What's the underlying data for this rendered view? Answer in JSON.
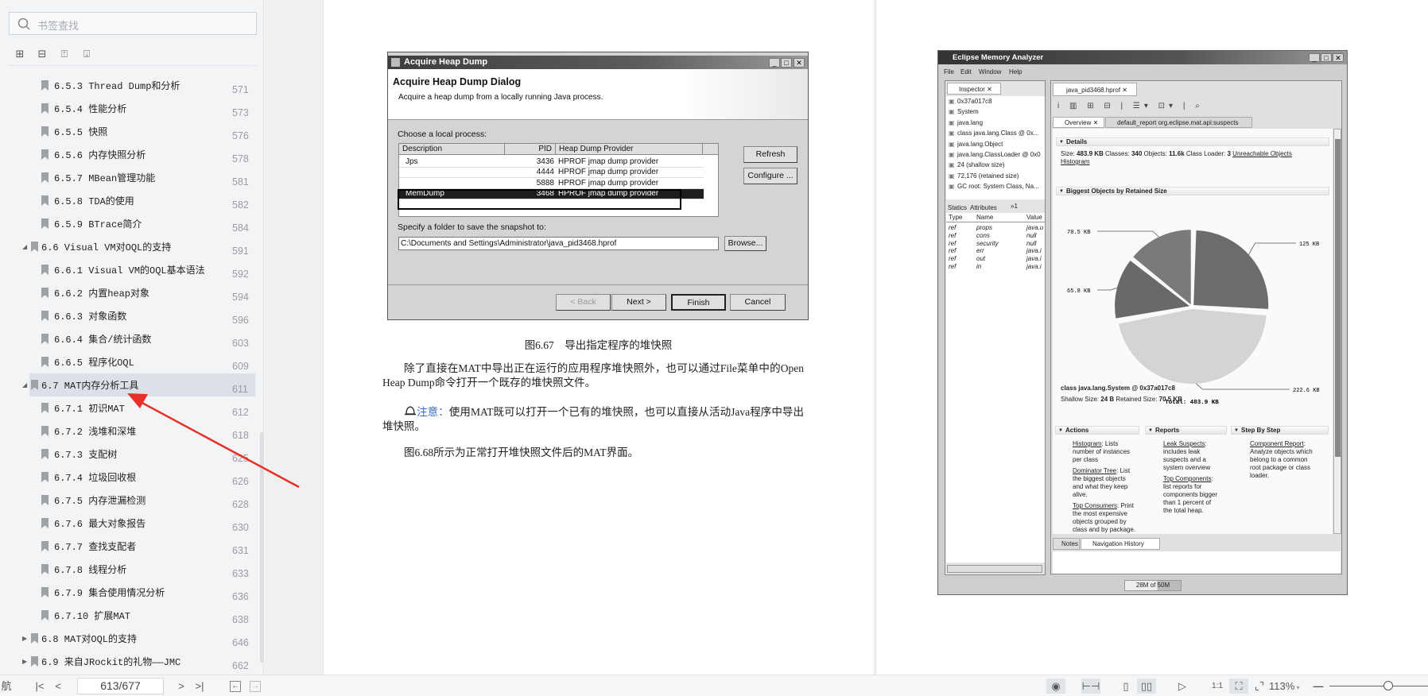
{
  "sidebar": {
    "search_placeholder": "书签查找",
    "tools": [
      "expand-all-icon",
      "collapse-all-icon",
      "add-bookmark-icon",
      "remove-bookmark-icon"
    ],
    "items": [
      {
        "label": "6.5.3 Thread Dump和分析",
        "page": "571",
        "level": 2
      },
      {
        "label": "6.5.4 性能分析",
        "page": "573",
        "level": 2
      },
      {
        "label": "6.5.5 快照",
        "page": "576",
        "level": 2
      },
      {
        "label": "6.5.6 内存快照分析",
        "page": "578",
        "level": 2
      },
      {
        "label": "6.5.7 MBean管理功能",
        "page": "581",
        "level": 2
      },
      {
        "label": "6.5.8 TDA的使用",
        "page": "582",
        "level": 2
      },
      {
        "label": "6.5.9 BTrace简介",
        "page": "584",
        "level": 2
      },
      {
        "label": "6.6 Visual VM对OQL的支持",
        "page": "591",
        "level": 1,
        "state": "expanded"
      },
      {
        "label": "6.6.1 Visual VM的OQL基本语法",
        "page": "592",
        "level": 2
      },
      {
        "label": "6.6.2 内置heap对象",
        "page": "594",
        "level": 2
      },
      {
        "label": "6.6.3 对象函数",
        "page": "596",
        "level": 2
      },
      {
        "label": "6.6.4 集合/统计函数",
        "page": "603",
        "level": 2
      },
      {
        "label": "6.6.5 程序化OQL",
        "page": "609",
        "level": 2
      },
      {
        "label": "6.7 MAT内存分析工具",
        "page": "611",
        "level": 1,
        "state": "expanded",
        "selected": true
      },
      {
        "label": "6.7.1 初识MAT",
        "page": "612",
        "level": 2
      },
      {
        "label": "6.7.2 浅堆和深堆",
        "page": "618",
        "level": 2
      },
      {
        "label": "6.7.3 支配树",
        "page": "625",
        "level": 2
      },
      {
        "label": "6.7.4 垃圾回收根",
        "page": "626",
        "level": 2
      },
      {
        "label": "6.7.5 内存泄漏检测",
        "page": "628",
        "level": 2
      },
      {
        "label": "6.7.6 最大对象报告",
        "page": "630",
        "level": 2
      },
      {
        "label": "6.7.7 查找支配者",
        "page": "631",
        "level": 2
      },
      {
        "label": "6.7.8 线程分析",
        "page": "633",
        "level": 2
      },
      {
        "label": "6.7.9 集合使用情况分析",
        "page": "636",
        "level": 2
      },
      {
        "label": "6.7.10 扩展MAT",
        "page": "638",
        "level": 2
      },
      {
        "label": "6.8 MAT对OQL的支持",
        "page": "646",
        "level": 1,
        "state": "collapsed"
      },
      {
        "label": "6.9 来自JRockit的礼物——JMC",
        "page": "662",
        "level": 1,
        "state": "collapsed"
      }
    ]
  },
  "annotation": {
    "arrow_color": "#e8302a"
  },
  "dialog": {
    "window_title": "Acquire Heap Dump",
    "heading": "Acquire Heap Dump Dialog",
    "subheading": "Acquire a heap dump from a locally running Java process.",
    "choose_label": "Choose a local process:",
    "columns": [
      "Description",
      "PID",
      "Heap Dump Provider"
    ],
    "rows": [
      {
        "desc": "Jps",
        "pid": "3436",
        "provider": "HPROF jmap dump provider"
      },
      {
        "desc": "",
        "pid": "4444",
        "provider": "HPROF jmap dump provider"
      },
      {
        "desc": "",
        "pid": "5888",
        "provider": "HPROF jmap dump provider"
      },
      {
        "desc": "MemDump",
        "pid": "3468",
        "provider": "HPROF jmap dump provider",
        "selected": true
      }
    ],
    "refresh": "Refresh",
    "configure": "Configure ...",
    "folder_label": "Specify a folder to save the snapshot to:",
    "folder_value": "C:\\Documents and Settings\\Administrator\\java_pid3468.hprof",
    "browse": "Browse...",
    "back": "< Back",
    "next": "Next >",
    "finish": "Finish",
    "cancel": "Cancel"
  },
  "document": {
    "caption": "图6.67　导出指定程序的堆快照",
    "para1": "除了直接在MAT中导出正在运行的应用程序堆快照外，也可以通过File菜单中的Open Heap Dump命令打开一个既存的堆快照文件。",
    "note_label": "注意：",
    "note_text": "使用MAT既可以打开一个已有的堆快照，也可以直接从活动Java程序中导出堆快照。",
    "para2": "图6.68所示为正常打开堆快照文件后的MAT界面。",
    "note_color": "#3a6fc4"
  },
  "mat": {
    "window_title": "Eclipse Memory Analyzer",
    "menu": [
      "File",
      "Edit",
      "Window",
      "Help"
    ],
    "inspector_tab": "Inspector",
    "inspector_items": [
      "0x37a017c8",
      "System",
      "java.lang",
      "class java.lang.Class @ 0x...",
      "java.lang.Object",
      "java.lang.ClassLoader @ 0x0",
      "24 (shallow size)",
      "72,176 (retained size)",
      "GC root: System Class, Na..."
    ],
    "statics_tabs": [
      "Statics",
      "Attributes",
      "»1"
    ],
    "statics_columns": [
      "Type",
      "Name",
      "Value"
    ],
    "statics_rows": [
      [
        "ref",
        "props",
        "java.u"
      ],
      [
        "ref",
        "cons",
        "null"
      ],
      [
        "ref",
        "security",
        "null"
      ],
      [
        "ref",
        "err",
        "java.i"
      ],
      [
        "ref",
        "out",
        "java.i"
      ],
      [
        "ref",
        "in",
        "java.i"
      ]
    ],
    "editor_tab": "java_pid3468.hprof",
    "overview_tab": "Overview",
    "report_tab": "default_report  org.eclipse.mat.api:suspects",
    "details_header": "Details",
    "details": {
      "size_label": "Size: ",
      "size": "483.9 KB",
      "classes_label": " Classes: ",
      "classes": "340",
      "objects_label": " Objects: ",
      "objects": "11.6k",
      "loader_label": " Class Loader: ",
      "loader": "3",
      "unreachable": "Unreachable Objects",
      "histogram": "Histogram"
    },
    "biggest_header": "Biggest Objects by Retained Size",
    "pie": {
      "type": "pie",
      "slices": [
        {
          "label": "125 KB",
          "value": 125,
          "color": "#6c6c6c"
        },
        {
          "label": "222.6 KB",
          "value": 222.6,
          "color": "#d4d4d4"
        },
        {
          "label": "65.8 KB",
          "value": 65.8,
          "color": "#696969"
        },
        {
          "label": "70.5 KB",
          "value": 70.5,
          "color": "#7a7a7a"
        }
      ],
      "total_label": "Total: 483.9 KB"
    },
    "selected_object": "class java.lang.System @ 0x37a017c8",
    "selected_sizes": {
      "shallow_label": "Shallow Size: ",
      "shallow": "24 B",
      "retained_label": " Retained Size: ",
      "retained": "70.5 KB"
    },
    "actions_header": "Actions",
    "reports_header": "Reports",
    "steps_header": "Step By Step",
    "actions": [
      {
        "link": "Histogram",
        "text": ": Lists number of instances per class"
      },
      {
        "link": "Dominator Tree",
        "text": ": List the biggest objects and what they keep alive."
      },
      {
        "link": "Top Consumers",
        "text": ": Print the most expensive objects grouped by class and by package."
      }
    ],
    "reports": [
      {
        "link": "Leak Suspects",
        "text": ": includes leak suspects and a system overview"
      },
      {
        "link": "Top Components",
        "text": ": list reports for components bigger than 1 percent of the total heap."
      }
    ],
    "steps": [
      {
        "link": "Component Report",
        "text": ": Analyze objects which belong to a common root package or class loader."
      }
    ],
    "bottom_tabs": [
      "Notes",
      "Navigation History"
    ],
    "heap_status": "28M of 50M"
  },
  "bottombar": {
    "nav_label": "航",
    "page_value": "613/677",
    "zoom": "113%",
    "zoom_slider_fraction": 0.6
  }
}
